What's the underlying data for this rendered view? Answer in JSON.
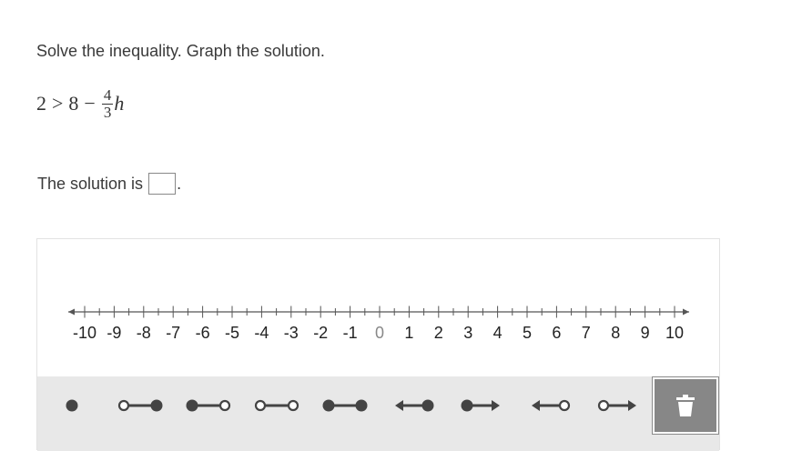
{
  "question": {
    "instructions": "Solve the inequality. Graph the solution.",
    "inequality": {
      "left": "2",
      "relation": ">",
      "right_constant": "8",
      "operator": "−",
      "fraction_numerator": "4",
      "fraction_denominator": "3",
      "variable": "h"
    },
    "solution_prefix": "The solution is",
    "solution_suffix": ".",
    "solution_value": ""
  },
  "number_line": {
    "min": -10,
    "max": 10,
    "minor_step": 0.5,
    "labels": [
      "-10",
      "-9",
      "-8",
      "-7",
      "-6",
      "-5",
      "-4",
      "-3",
      "-2",
      "-1",
      "0",
      "1",
      "2",
      "3",
      "4",
      "5",
      "6",
      "7",
      "8",
      "9",
      "10"
    ]
  },
  "tools": [
    {
      "name": "point-tool",
      "icon": "closed-point-icon",
      "kind": "point"
    },
    {
      "name": "open-closed-segment-tool",
      "icon": "open-closed-segment-icon",
      "kind": "seg-oc"
    },
    {
      "name": "closed-open-segment-tool",
      "icon": "closed-open-segment-icon",
      "kind": "seg-co"
    },
    {
      "name": "open-open-segment-tool",
      "icon": "open-open-segment-icon",
      "kind": "seg-oo"
    },
    {
      "name": "closed-closed-segment-tool",
      "icon": "closed-closed-segment-icon",
      "kind": "seg-cc"
    },
    {
      "name": "left-ray-closed-tool",
      "icon": "left-ray-closed-icon",
      "kind": "ray-left-closed"
    },
    {
      "name": "right-ray-closed-tool",
      "icon": "right-ray-closed-icon",
      "kind": "ray-right-closed"
    },
    {
      "name": "left-ray-open-tool",
      "icon": "left-ray-open-icon",
      "kind": "ray-left-open"
    },
    {
      "name": "right-ray-open-tool",
      "icon": "right-ray-open-icon",
      "kind": "ray-right-open"
    }
  ],
  "delete_button": {
    "icon": "trash-icon"
  },
  "colors": {
    "text": "#3a3a3a",
    "axis": "#555555",
    "zero_label": "#888888",
    "toolbar_bg": "#e8e8e8",
    "tool_glyph": "#444444",
    "delete_bg": "#878787"
  }
}
